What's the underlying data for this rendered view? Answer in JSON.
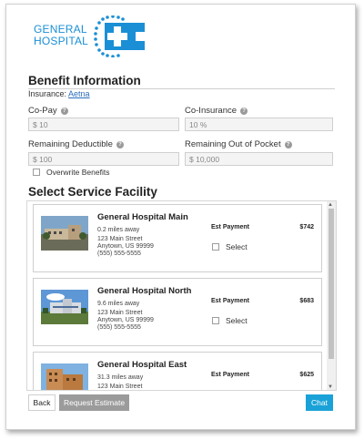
{
  "logo": {
    "line1": "GENERAL",
    "line2": "HOSPITAL"
  },
  "benefit": {
    "title": "Benefit Information",
    "insurance_label": "Insurance:",
    "insurance_name": "Aetna",
    "copay_label": "Co-Pay",
    "copay_value": "$ 10",
    "coinsurance_label": "Co-Insurance",
    "coinsurance_value": "10 %",
    "deductible_label": "Remaining Deductible",
    "deductible_value": "$ 100",
    "oop_label": "Remaining Out of Pocket",
    "oop_value": "$ 10,000",
    "overwrite_label": "Overwrite Benefits",
    "help_glyph": "?"
  },
  "facility_section": {
    "title": "Select Service Facility",
    "est_label": "Est Payment",
    "select_label": "Select",
    "facilities": [
      {
        "name": "General Hospital Main",
        "distance": "0.2 miles away",
        "street": "123 Main Street",
        "city": "Anytown, US 99999",
        "phone": "(555) 555-5555",
        "payment": "$742"
      },
      {
        "name": "General Hospital North",
        "distance": "9.6 miles away",
        "street": "123 Main Street",
        "city": "Anytown, US 99999",
        "phone": "(555) 555-5555",
        "payment": "$683"
      },
      {
        "name": "General Hospital East",
        "distance": "31.3 miles away",
        "street": "123 Main Street",
        "city": "",
        "phone": "",
        "payment": "$625"
      }
    ]
  },
  "buttons": {
    "back": "Back",
    "request": "Request Estimate",
    "chat": "Chat"
  },
  "icons": {
    "help": "help-icon",
    "scroll_up": "arrow-up-icon",
    "scroll_down": "arrow-down-icon"
  },
  "colors": {
    "brand": "#1a8fd6",
    "chat": "#1aa2d8",
    "disabled": "#9b9b9b",
    "link": "#2a6ebb"
  }
}
